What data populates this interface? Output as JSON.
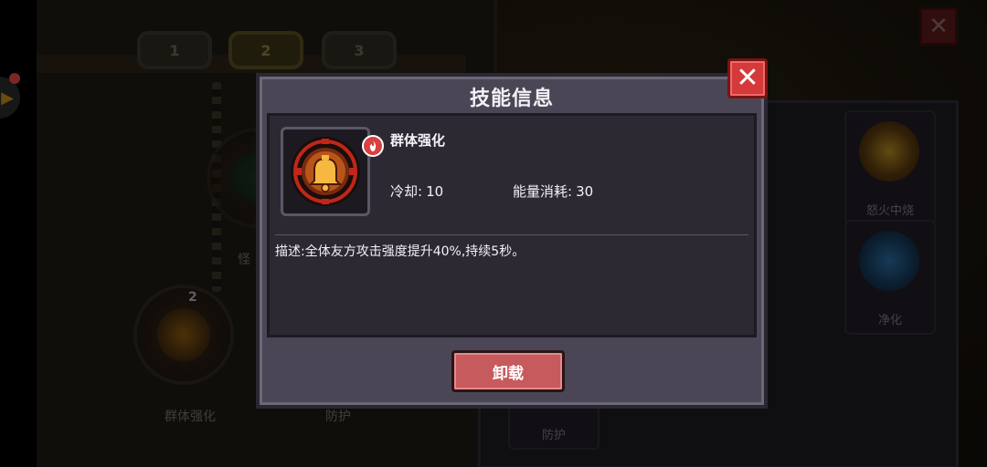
{
  "modal": {
    "title": "技能信息",
    "close_icon": "close-icon",
    "skill": {
      "name": "群体强化",
      "icon": "bell-icon",
      "badge_icon": "fire-element-icon",
      "cooldown_label": "冷却:",
      "cooldown_value": "10",
      "energy_label": "能量消耗:",
      "energy_value": "30",
      "description_label": "描述:",
      "description_value": "全体友方攻击强度提升40%,持续5秒。"
    },
    "action_button": "卸载"
  },
  "background": {
    "tabs": [
      "1",
      "2",
      "3"
    ],
    "active_tab": "2",
    "equipped_skill": {
      "level": "2",
      "label": "群体强化"
    },
    "partial_labels": {
      "monster": "怪",
      "defense": "防护"
    },
    "grid_cards": [
      {
        "label": "怒火中烧",
        "icon": "burst-icon"
      },
      {
        "label": "净化",
        "icon": "fist-icon"
      },
      {
        "label": "防护",
        "icon": "shield-icon"
      }
    ]
  },
  "colors": {
    "accent_red": "#d43a3a",
    "button_red": "#c75a5c",
    "modal_bg": "#4b4655",
    "content_bg": "#2c2933"
  }
}
